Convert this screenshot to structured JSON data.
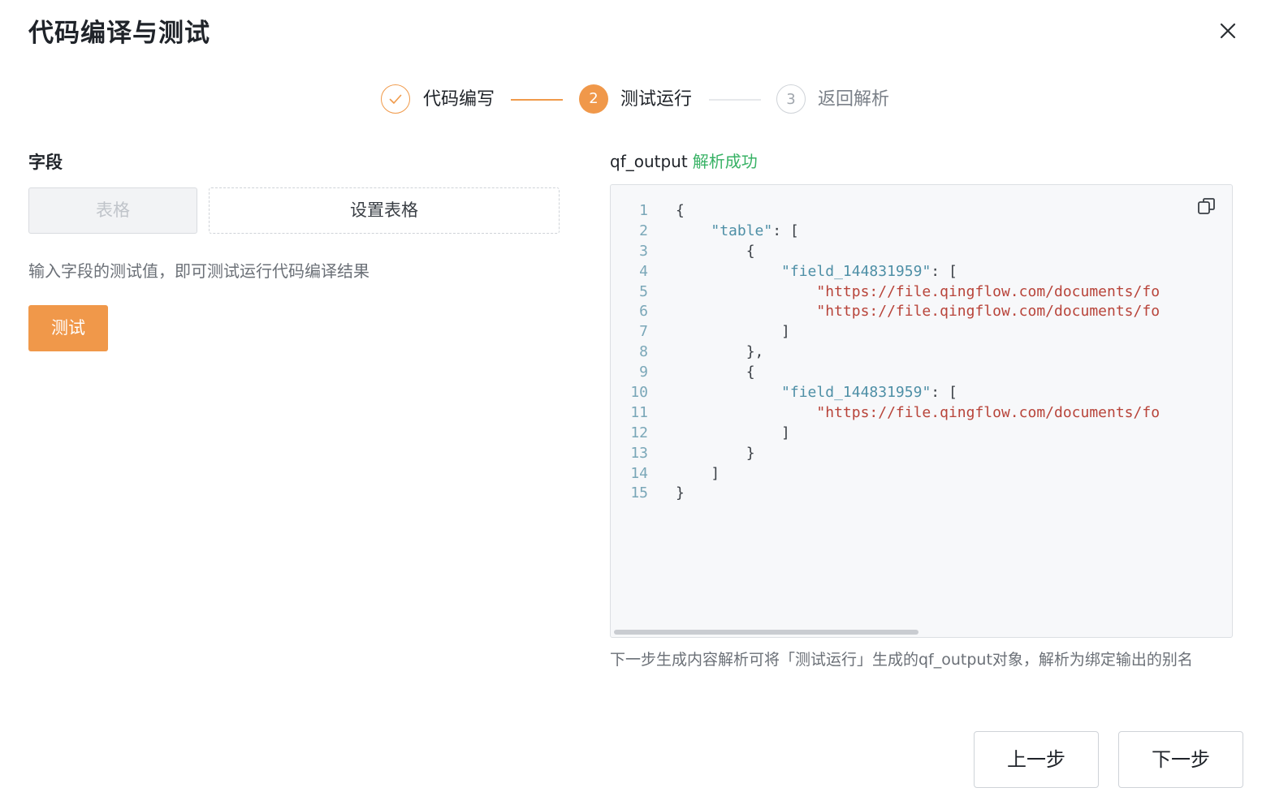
{
  "dialog": {
    "title": "代码编译与测试",
    "close_icon": "close-icon"
  },
  "steps": [
    {
      "index": "1",
      "label": "代码编写",
      "status": "done",
      "icon": "check-icon"
    },
    {
      "index": "2",
      "label": "测试运行",
      "status": "active"
    },
    {
      "index": "3",
      "label": "返回解析",
      "status": "todo"
    }
  ],
  "left": {
    "field_label": "字段",
    "field_value": "表格",
    "set_table_button": "设置表格",
    "hint": "输入字段的测试值，即可测试运行代码编译结果",
    "test_button": "测试"
  },
  "right": {
    "output_name": "qf_output",
    "output_status": "解析成功",
    "copy_icon": "copy-icon",
    "code_lines": [
      {
        "n": "1",
        "indent": "",
        "parts": [
          [
            "punc",
            "{"
          ]
        ]
      },
      {
        "n": "2",
        "indent": "    ",
        "parts": [
          [
            "key",
            "\"table\""
          ],
          [
            "punc",
            ": ["
          ]
        ]
      },
      {
        "n": "3",
        "indent": "        ",
        "parts": [
          [
            "punc",
            "{"
          ]
        ]
      },
      {
        "n": "4",
        "indent": "            ",
        "parts": [
          [
            "key",
            "\"field_144831959\""
          ],
          [
            "punc",
            ": ["
          ]
        ]
      },
      {
        "n": "5",
        "indent": "                ",
        "parts": [
          [
            "str",
            "\"https://file.qingflow.com/documents/fo"
          ]
        ]
      },
      {
        "n": "6",
        "indent": "                ",
        "parts": [
          [
            "str",
            "\"https://file.qingflow.com/documents/fo"
          ]
        ]
      },
      {
        "n": "7",
        "indent": "            ",
        "parts": [
          [
            "punc",
            "]"
          ]
        ]
      },
      {
        "n": "8",
        "indent": "        ",
        "parts": [
          [
            "punc",
            "},"
          ]
        ]
      },
      {
        "n": "9",
        "indent": "        ",
        "parts": [
          [
            "punc",
            "{"
          ]
        ]
      },
      {
        "n": "10",
        "indent": "            ",
        "parts": [
          [
            "key",
            "\"field_144831959\""
          ],
          [
            "punc",
            ": ["
          ]
        ]
      },
      {
        "n": "11",
        "indent": "                ",
        "parts": [
          [
            "str",
            "\"https://file.qingflow.com/documents/fo"
          ]
        ]
      },
      {
        "n": "12",
        "indent": "            ",
        "parts": [
          [
            "punc",
            "]"
          ]
        ]
      },
      {
        "n": "13",
        "indent": "        ",
        "parts": [
          [
            "punc",
            "}"
          ]
        ]
      },
      {
        "n": "14",
        "indent": "    ",
        "parts": [
          [
            "punc",
            "]"
          ]
        ]
      },
      {
        "n": "15",
        "indent": "",
        "parts": [
          [
            "punc",
            "}"
          ]
        ]
      }
    ],
    "note": "下一步生成内容解析可将「测试运行」生成的qf_output对象，解析为绑定输出的别名"
  },
  "footer": {
    "prev_button": "上一步",
    "next_button": "下一步"
  },
  "colors": {
    "accent": "#f0984a",
    "success": "#38b265",
    "code_key": "#4e8fa6",
    "code_string": "#b8443a"
  }
}
